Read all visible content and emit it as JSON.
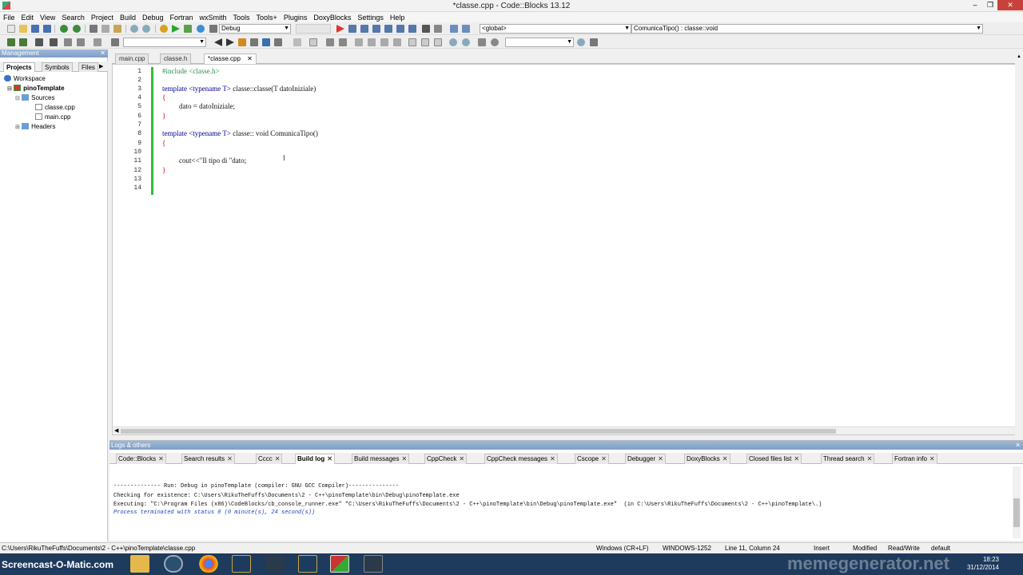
{
  "window": {
    "title": "*classe.cpp - Code::Blocks 13.12"
  },
  "menu": [
    "File",
    "Edit",
    "View",
    "Search",
    "Project",
    "Build",
    "Debug",
    "Fortran",
    "wxSmith",
    "Tools",
    "Tools+",
    "Plugins",
    "DoxyBlocks",
    "Settings",
    "Help"
  ],
  "toolbar": {
    "build_target": "Debug",
    "scope": "<global>",
    "function": "ComunicaTipo() : classe::void"
  },
  "management": {
    "title": "Management",
    "tabs": [
      "Projects",
      "Symbols",
      "Files"
    ],
    "tree": [
      {
        "label": "Workspace"
      },
      {
        "label": "pinoTemplate"
      },
      {
        "label": "Sources"
      },
      {
        "label": "classe.cpp"
      },
      {
        "label": "main.cpp"
      },
      {
        "label": "Headers"
      }
    ]
  },
  "editor": {
    "tabs": [
      "main.cpp",
      "classe.h",
      "*classe.cpp"
    ],
    "lines": [
      "1",
      "2",
      "3",
      "4",
      "5",
      "6",
      "7",
      "8",
      "9",
      "10",
      "11",
      "12",
      "13",
      "14"
    ],
    "code": {
      "l1": "#include <classe.h>",
      "l3a": "template <typename T>",
      "l3b": " classe::classe(T datoIniziale)",
      "l4": "{",
      "l5": "dato = datoIniziale;",
      "l6": "}",
      "l8a": "template <typename T>",
      "l8b": " classe:: void ComunicaTipo()",
      "l9": "{",
      "l11": "cout<<\"Il tipo di \"dato;",
      "l12": "}"
    }
  },
  "logs": {
    "title": "Logs & others",
    "tabs": [
      "Code::Blocks",
      "Search results",
      "Cccc",
      "Build log",
      "Build messages",
      "CppCheck",
      "CppCheck messages",
      "Cscope",
      "Debugger",
      "DoxyBlocks",
      "Closed files list",
      "Thread search",
      "Fortran info"
    ],
    "lines": [
      "-------------- Run: Debug in pinoTemplate (compiler: GNU GCC Compiler)---------------",
      "Checking for existence: C:\\Users\\RikuTheFuffs\\Documents\\2 - C++\\pinoTemplate\\bin\\Debug\\pinoTemplate.exe",
      "Executing: \"C:\\Program Files (x86)\\CodeBlocks/cb_console_runner.exe\" \"C:\\Users\\RikuTheFuffs\\Documents\\2 - C++\\pinoTemplate\\bin\\Debug\\pinoTemplate.exe\"  (in C:\\Users\\RikuTheFuffs\\Documents\\2 - C++\\pinoTemplate\\.)",
      "Process terminated with status 0 (0 minute(s), 24 second(s))"
    ]
  },
  "status": {
    "path": "C:\\Users\\RikuTheFuffs\\Documents\\2 - C++\\pinoTemplate\\classe.cpp",
    "eol": "Windows (CR+LF)",
    "encoding": "WINDOWS-1252",
    "position": "Line 11, Column 24",
    "mode": "Insert",
    "modified": "Modified",
    "access": "Read/Write",
    "profile": "default"
  },
  "taskbar": {
    "watermark": "Screencast-O-Matic.com",
    "meme": "memegenerator.net",
    "time": "18:23",
    "date": "31/12/2014"
  }
}
